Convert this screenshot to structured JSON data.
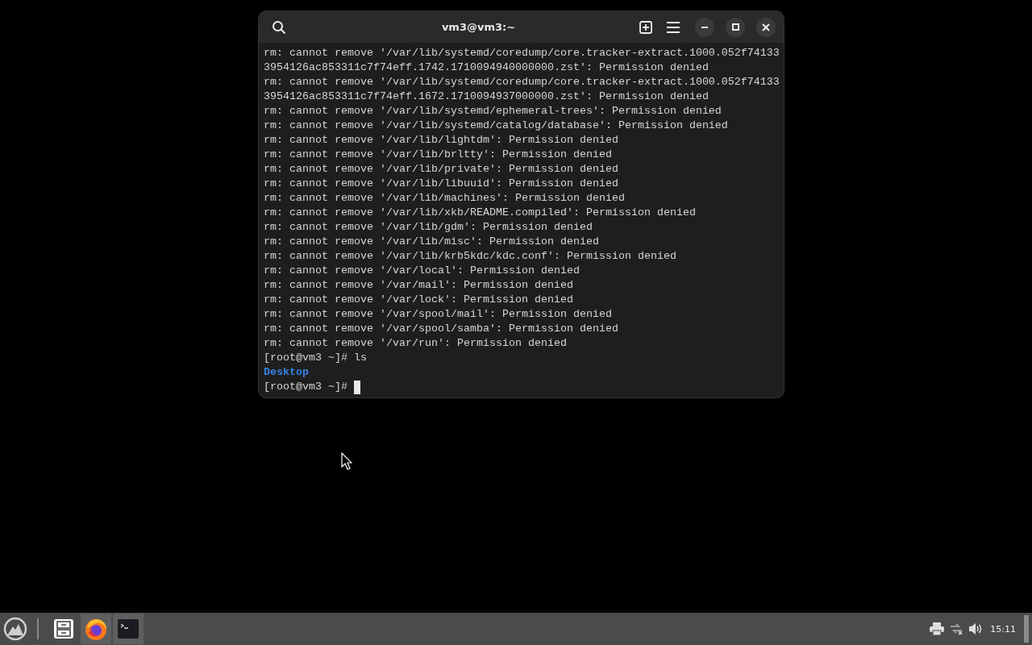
{
  "terminal": {
    "title": "vm3@vm3:~",
    "cursor_visible": true,
    "lines": [
      {
        "kind": "output",
        "text": "rm: cannot remove '/var/lib/systemd/coredump/core.tracker-extract.1000.052f74133"
      },
      {
        "kind": "output",
        "text": "3954126ac853311c7f74eff.1742.1710094940000000.zst': Permission denied"
      },
      {
        "kind": "output",
        "text": "rm: cannot remove '/var/lib/systemd/coredump/core.tracker-extract.1000.052f74133"
      },
      {
        "kind": "output",
        "text": "3954126ac853311c7f74eff.1672.1710094937000000.zst': Permission denied"
      },
      {
        "kind": "output",
        "text": "rm: cannot remove '/var/lib/systemd/ephemeral-trees': Permission denied"
      },
      {
        "kind": "output",
        "text": "rm: cannot remove '/var/lib/systemd/catalog/database': Permission denied"
      },
      {
        "kind": "output",
        "text": "rm: cannot remove '/var/lib/lightdm': Permission denied"
      },
      {
        "kind": "output",
        "text": "rm: cannot remove '/var/lib/brltty': Permission denied"
      },
      {
        "kind": "output",
        "text": "rm: cannot remove '/var/lib/private': Permission denied"
      },
      {
        "kind": "output",
        "text": "rm: cannot remove '/var/lib/libuuid': Permission denied"
      },
      {
        "kind": "output",
        "text": "rm: cannot remove '/var/lib/machines': Permission denied"
      },
      {
        "kind": "output",
        "text": "rm: cannot remove '/var/lib/xkb/README.compiled': Permission denied"
      },
      {
        "kind": "output",
        "text": "rm: cannot remove '/var/lib/gdm': Permission denied"
      },
      {
        "kind": "output",
        "text": "rm: cannot remove '/var/lib/misc': Permission denied"
      },
      {
        "kind": "output",
        "text": "rm: cannot remove '/var/lib/krb5kdc/kdc.conf': Permission denied"
      },
      {
        "kind": "output",
        "text": "rm: cannot remove '/var/local': Permission denied"
      },
      {
        "kind": "output",
        "text": "rm: cannot remove '/var/mail': Permission denied"
      },
      {
        "kind": "output",
        "text": "rm: cannot remove '/var/lock': Permission denied"
      },
      {
        "kind": "output",
        "text": "rm: cannot remove '/var/spool/mail': Permission denied"
      },
      {
        "kind": "output",
        "text": "rm: cannot remove '/var/spool/samba': Permission denied"
      },
      {
        "kind": "output",
        "text": "rm: cannot remove '/var/run': Permission denied"
      },
      {
        "kind": "prompt",
        "text": "[root@vm3 ~]# ls"
      },
      {
        "kind": "directory",
        "text": "Desktop"
      },
      {
        "kind": "prompt",
        "text": "[root@vm3 ~]#"
      }
    ]
  },
  "taskbar": {
    "apps": [
      {
        "kind": "files",
        "selected": false
      },
      {
        "kind": "browser",
        "selected": true
      },
      {
        "kind": "terminal",
        "selected": true
      }
    ],
    "clock": "15:11"
  }
}
